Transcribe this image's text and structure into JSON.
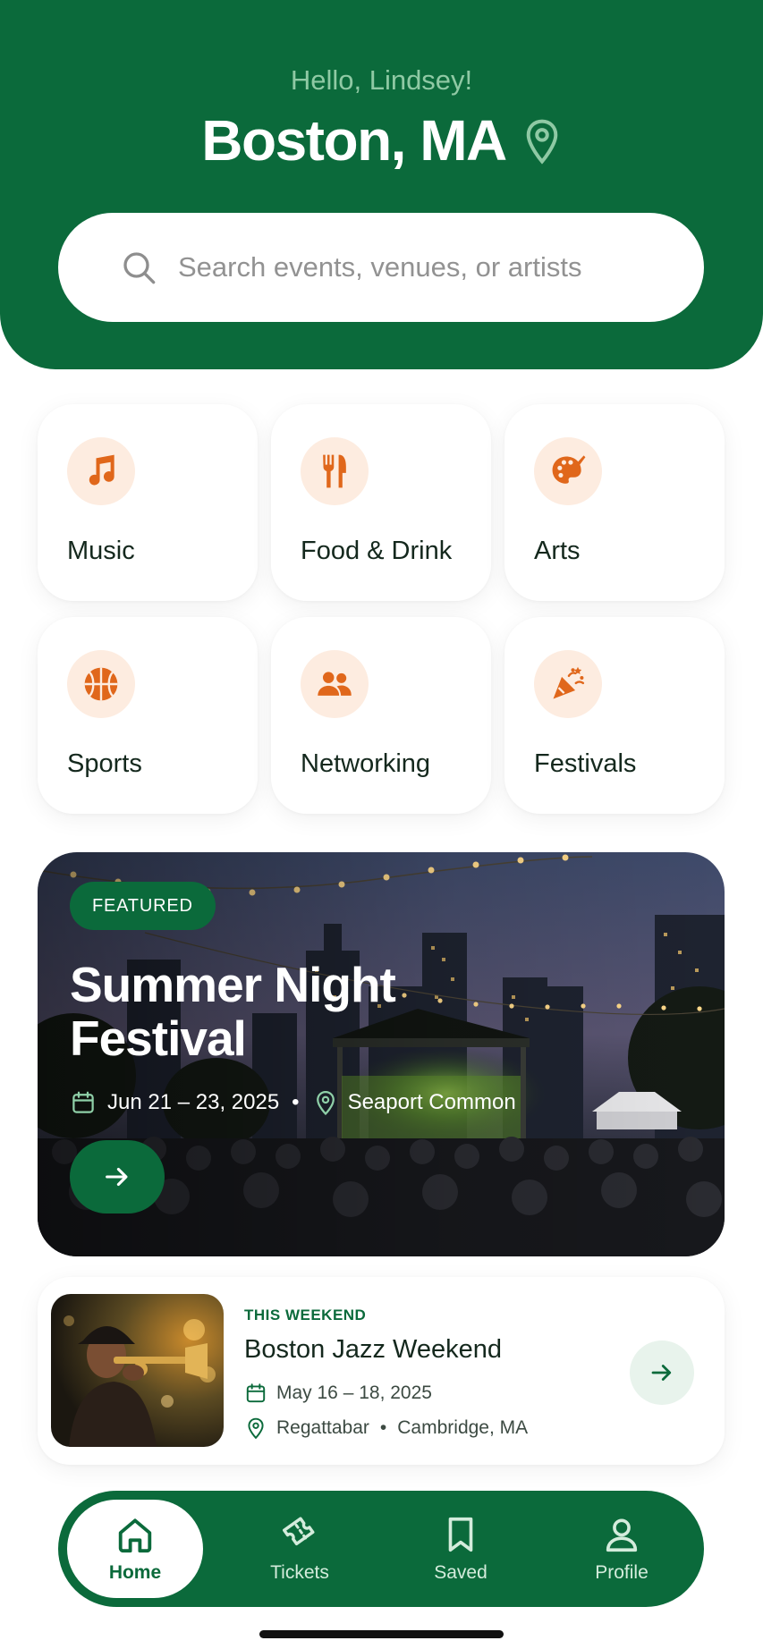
{
  "header": {
    "greeting": "Hello, Lindsey!",
    "city": "Boston, MA",
    "location_icon": "map-pin-icon"
  },
  "search": {
    "placeholder": "Search events, venues, or artists",
    "icon": "search-icon"
  },
  "categories": [
    {
      "label": "Music",
      "icon": "music-note-icon"
    },
    {
      "label": "Food & Drink",
      "icon": "fork-knife-icon"
    },
    {
      "label": "Arts",
      "icon": "palette-icon"
    },
    {
      "label": "Sports",
      "icon": "basketball-icon"
    },
    {
      "label": "Networking",
      "icon": "people-icon"
    },
    {
      "label": "Festivals",
      "icon": "party-popper-icon"
    }
  ],
  "featured": {
    "badge": "FEATURED",
    "title": "Summer Night Festival",
    "date": "Jun 21 – 23, 2025",
    "separator": "•",
    "venue": "Seaport Common",
    "arrow_icon": "arrow-right-icon"
  },
  "weekend": {
    "tag": "THIS WEEKEND",
    "title": "Boston Jazz Weekend",
    "date": "May 16 – 18, 2025",
    "venue": "Regattabar",
    "separator": "•",
    "city": "Cambridge, MA",
    "arrow_icon": "arrow-right-icon"
  },
  "nav": {
    "items": [
      {
        "label": "Home",
        "icon": "home-icon",
        "active": true
      },
      {
        "label": "Tickets",
        "icon": "ticket-icon",
        "active": false
      },
      {
        "label": "Saved",
        "icon": "bookmark-icon",
        "active": false
      },
      {
        "label": "Profile",
        "icon": "user-icon",
        "active": false
      }
    ]
  },
  "colors": {
    "brand_green": "#0b6a3b",
    "accent_orange": "#e0671b",
    "icon_bg_peach": "#fdece0"
  }
}
